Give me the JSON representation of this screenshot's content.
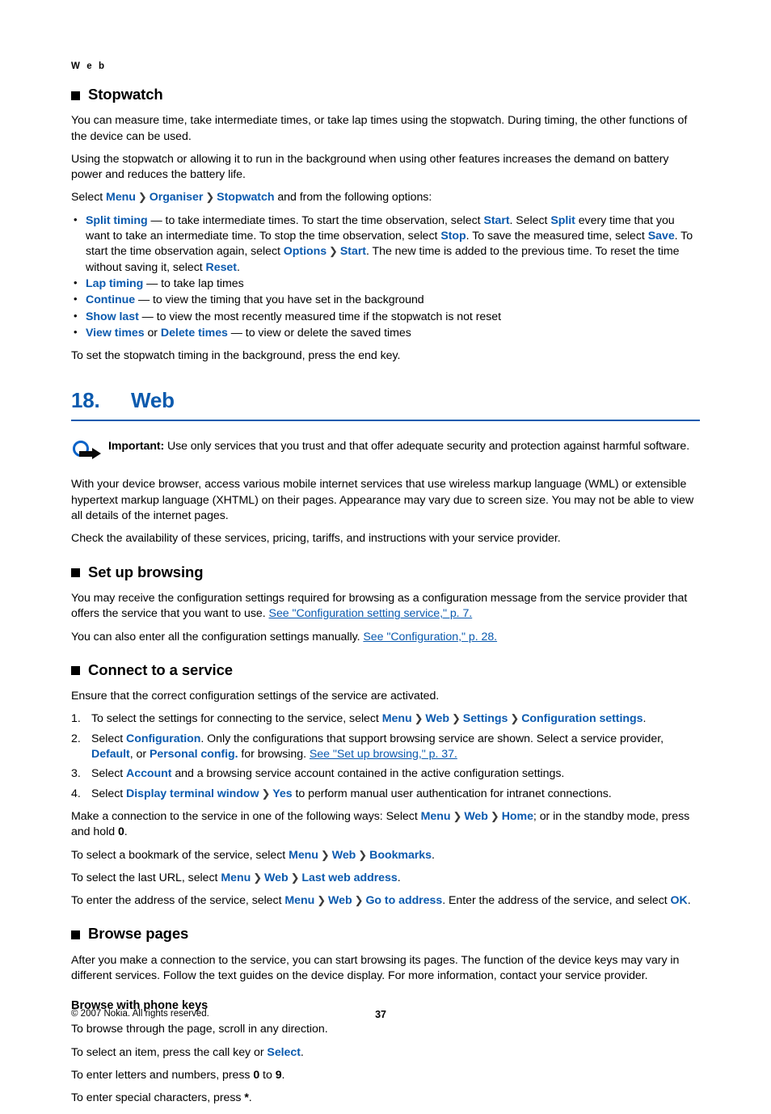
{
  "page": {
    "running_head": "W e b",
    "page_number": "37",
    "copyright": "© 2007 Nokia. All rights reserved.",
    "accent_color": "#0B5AAE",
    "link_color": "#0B5AAE"
  },
  "stopwatch": {
    "heading": "Stopwatch",
    "para1": "You can measure time, take intermediate times, or take lap times using the stopwatch. During timing, the other functions of the device can be used.",
    "para2": "Using the stopwatch or allowing it to run in the background when using other features increases the demand on battery power and reduces the battery life.",
    "select_lead": "Select",
    "path": [
      "Menu",
      "Organiser",
      "Stopwatch"
    ],
    "select_tail": "and from the following options:",
    "options": [
      {
        "term": "Split timing",
        "segments": [
          {
            "t": " — to take intermediate times. To start the time observation, select ",
            "s": "plain"
          },
          {
            "t": "Start",
            "s": "blue"
          },
          {
            "t": ". Select ",
            "s": "plain"
          },
          {
            "t": "Split",
            "s": "blue"
          },
          {
            "t": " every time that you want to take an intermediate time. To stop the time observation, select ",
            "s": "plain"
          },
          {
            "t": "Stop",
            "s": "blue"
          },
          {
            "t": ". To save the measured time, select ",
            "s": "plain"
          },
          {
            "t": "Save",
            "s": "blue"
          },
          {
            "t": ". To start the time observation again, select ",
            "s": "plain"
          },
          {
            "t": "Options",
            "s": "blue"
          },
          {
            "t": " ",
            "s": "sep"
          },
          {
            "t": "Start",
            "s": "blue"
          },
          {
            "t": ". The new time is added to the previous time. To reset the time without saving it, select ",
            "s": "plain"
          },
          {
            "t": "Reset",
            "s": "blue"
          },
          {
            "t": ".",
            "s": "plain"
          }
        ]
      },
      {
        "term": "Lap timing",
        "segments": [
          {
            "t": " — to take lap times",
            "s": "plain"
          }
        ]
      },
      {
        "term": "Continue",
        "segments": [
          {
            "t": " — to view the timing that you have set in the background",
            "s": "plain"
          }
        ]
      },
      {
        "term": "Show last",
        "segments": [
          {
            "t": " — to view the most recently measured time if the stopwatch is not reset",
            "s": "plain"
          }
        ]
      },
      {
        "term": "View times",
        "segments": [
          {
            "t": " or ",
            "s": "plain"
          },
          {
            "t": "Delete times",
            "s": "blue"
          },
          {
            "t": " — to view or delete the saved times",
            "s": "plain"
          }
        ]
      }
    ],
    "para3": "To set the stopwatch timing in the background, press the end key."
  },
  "chapter": {
    "number": "18.",
    "title": "Web"
  },
  "important": {
    "icon": "important-arrow-icon",
    "label": "Important:",
    "text": "Use only services that you trust and that offer adequate security and protection against harmful software."
  },
  "web_intro": {
    "para1": "With your device browser, access various mobile internet services that use wireless markup language (WML) or extensible hypertext markup language (XHTML) on their pages. Appearance may vary due to screen size. You may not be able to view all details of the internet pages.",
    "para2": "Check the availability of these services, pricing, tariffs, and instructions with your service provider."
  },
  "setup_browsing": {
    "heading": "Set up browsing",
    "para1_text": "You may receive the configuration settings required for browsing as a configuration message from the service provider that offers the service that you want to use. ",
    "para1_link": "See \"Configuration setting service,\" p. 7.",
    "para2_text": "You can also enter all the configuration settings manually. ",
    "para2_link": "See \"Configuration,\" p. 28."
  },
  "connect_service": {
    "heading": "Connect to a service",
    "intro": "Ensure that the correct configuration settings of the service are activated.",
    "steps": [
      [
        {
          "t": "To select the settings for connecting to the service, select ",
          "s": "plain"
        },
        {
          "t": "Menu",
          "s": "blue"
        },
        {
          "t": " ",
          "s": "sep"
        },
        {
          "t": "Web",
          "s": "blue"
        },
        {
          "t": " ",
          "s": "sep"
        },
        {
          "t": "Settings",
          "s": "blue"
        },
        {
          "t": " ",
          "s": "sep"
        },
        {
          "t": "Configuration settings",
          "s": "blue"
        },
        {
          "t": ".",
          "s": "plain"
        }
      ],
      [
        {
          "t": "Select ",
          "s": "plain"
        },
        {
          "t": "Configuration",
          "s": "blue"
        },
        {
          "t": ". Only the configurations that support browsing service are shown. Select a service provider, ",
          "s": "plain"
        },
        {
          "t": "Default",
          "s": "blue"
        },
        {
          "t": ", or ",
          "s": "plain"
        },
        {
          "t": "Personal config.",
          "s": "blue"
        },
        {
          "t": " for browsing. ",
          "s": "plain"
        },
        {
          "t": "See \"Set up browsing,\" p. 37.",
          "s": "link"
        }
      ],
      [
        {
          "t": "Select ",
          "s": "plain"
        },
        {
          "t": "Account",
          "s": "blue"
        },
        {
          "t": " and a browsing service account contained in the active configuration settings.",
          "s": "plain"
        }
      ],
      [
        {
          "t": "Select ",
          "s": "plain"
        },
        {
          "t": "Display terminal window",
          "s": "blue"
        },
        {
          "t": " ",
          "s": "sep"
        },
        {
          "t": "Yes",
          "s": "blue"
        },
        {
          "t": " to perform manual user authentication for intranet connections.",
          "s": "plain"
        }
      ]
    ],
    "paras": [
      [
        {
          "t": "Make a connection to the service in one of the following ways: Select ",
          "s": "plain"
        },
        {
          "t": "Menu",
          "s": "blue"
        },
        {
          "t": " ",
          "s": "sep"
        },
        {
          "t": "Web",
          "s": "blue"
        },
        {
          "t": " ",
          "s": "sep"
        },
        {
          "t": "Home",
          "s": "blue"
        },
        {
          "t": "; or in the standby mode, press and hold ",
          "s": "plain"
        },
        {
          "t": "0",
          "s": "bold"
        },
        {
          "t": ".",
          "s": "plain"
        }
      ],
      [
        {
          "t": "To select a bookmark of the service, select ",
          "s": "plain"
        },
        {
          "t": "Menu",
          "s": "blue"
        },
        {
          "t": " ",
          "s": "sep"
        },
        {
          "t": "Web",
          "s": "blue"
        },
        {
          "t": " ",
          "s": "sep"
        },
        {
          "t": "Bookmarks",
          "s": "blue"
        },
        {
          "t": ".",
          "s": "plain"
        }
      ],
      [
        {
          "t": "To select the last URL, select ",
          "s": "plain"
        },
        {
          "t": "Menu",
          "s": "blue"
        },
        {
          "t": " ",
          "s": "sep"
        },
        {
          "t": "Web",
          "s": "blue"
        },
        {
          "t": " ",
          "s": "sep"
        },
        {
          "t": "Last web address",
          "s": "blue"
        },
        {
          "t": ".",
          "s": "plain"
        }
      ],
      [
        {
          "t": "To enter the address of the service, select ",
          "s": "plain"
        },
        {
          "t": "Menu",
          "s": "blue"
        },
        {
          "t": " ",
          "s": "sep"
        },
        {
          "t": "Web",
          "s": "blue"
        },
        {
          "t": " ",
          "s": "sep"
        },
        {
          "t": "Go to address",
          "s": "blue"
        },
        {
          "t": ". Enter the address of the service, and select ",
          "s": "plain"
        },
        {
          "t": "OK",
          "s": "blue"
        },
        {
          "t": ".",
          "s": "plain"
        }
      ]
    ]
  },
  "browse_pages": {
    "heading": "Browse pages",
    "para1": "After you make a connection to the service, you can start browsing its pages. The function of the device keys may vary in different services. Follow the text guides on the device display. For more information, contact your service provider.",
    "subheading": "Browse with phone keys",
    "lines": [
      [
        {
          "t": "To browse through the page, scroll in any direction.",
          "s": "plain"
        }
      ],
      [
        {
          "t": "To select an item, press the call key or ",
          "s": "plain"
        },
        {
          "t": "Select",
          "s": "blue"
        },
        {
          "t": ".",
          "s": "plain"
        }
      ],
      [
        {
          "t": "To enter letters and numbers, press ",
          "s": "plain"
        },
        {
          "t": "0",
          "s": "bold"
        },
        {
          "t": " to ",
          "s": "plain"
        },
        {
          "t": "9",
          "s": "bold"
        },
        {
          "t": ".",
          "s": "plain"
        }
      ],
      [
        {
          "t": "To enter special characters, press ",
          "s": "plain"
        },
        {
          "t": "*",
          "s": "bold"
        },
        {
          "t": ".",
          "s": "plain"
        }
      ]
    ]
  }
}
